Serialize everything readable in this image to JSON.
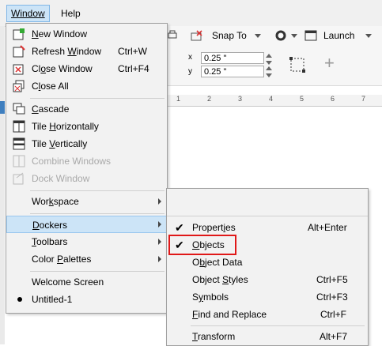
{
  "menubar": {
    "window": "Window",
    "help": "Help"
  },
  "toolbar": {
    "snap_to": "Snap To",
    "launch": "Launch",
    "x_value": "0.25 \"",
    "y_value": "0.25 \"",
    "x_prefix": "x",
    "y_prefix": "y",
    "add": "+"
  },
  "ruler": {
    "ticks": [
      "1",
      "2",
      "3",
      "4",
      "5",
      "6",
      "7"
    ]
  },
  "window_menu": {
    "items": [
      {
        "pre": "",
        "ul": "N",
        "post": "ew Window",
        "shortcut": ""
      },
      {
        "pre": "Refresh ",
        "ul": "W",
        "post": "indow",
        "shortcut": "Ctrl+W"
      },
      {
        "pre": "Cl",
        "ul": "o",
        "post": "se Window",
        "shortcut": "Ctrl+F4"
      },
      {
        "pre": "C",
        "ul": "l",
        "post": "ose All",
        "shortcut": ""
      },
      {
        "pre": "",
        "ul": "C",
        "post": "ascade",
        "shortcut": ""
      },
      {
        "pre": "Tile ",
        "ul": "H",
        "post": "orizontally",
        "shortcut": ""
      },
      {
        "pre": "Tile ",
        "ul": "V",
        "post": "ertically",
        "shortcut": ""
      },
      {
        "pre": "Combine Windows",
        "ul": "",
        "post": "",
        "shortcut": ""
      },
      {
        "pre": "Dock Window",
        "ul": "",
        "post": "",
        "shortcut": ""
      },
      {
        "pre": "Wor",
        "ul": "k",
        "post": "space",
        "shortcut": ""
      },
      {
        "pre": "",
        "ul": "D",
        "post": "ockers",
        "shortcut": ""
      },
      {
        "pre": "",
        "ul": "T",
        "post": "oolbars",
        "shortcut": ""
      },
      {
        "pre": "Color ",
        "ul": "P",
        "post": "alettes",
        "shortcut": ""
      },
      {
        "pre": "Welcome Screen",
        "ul": "",
        "post": "",
        "shortcut": ""
      },
      {
        "pre": "Untitled-1",
        "ul": "",
        "post": "",
        "shortcut": ""
      }
    ]
  },
  "dockers_menu": {
    "items": [
      {
        "pre": "Propert",
        "ul": "i",
        "post": "es",
        "shortcut": "Alt+Enter"
      },
      {
        "pre": "",
        "ul": "O",
        "post": "bjects",
        "shortcut": ""
      },
      {
        "pre": "O",
        "ul": "b",
        "post": "ject Data",
        "shortcut": ""
      },
      {
        "pre": "Object ",
        "ul": "S",
        "post": "tyles",
        "shortcut": "Ctrl+F5"
      },
      {
        "pre": "S",
        "ul": "y",
        "post": "mbols",
        "shortcut": "Ctrl+F3"
      },
      {
        "pre": "",
        "ul": "F",
        "post": "ind and Replace",
        "shortcut": "Ctrl+F"
      },
      {
        "pre": "",
        "ul": "T",
        "post": "ransform",
        "shortcut": "Alt+F7"
      }
    ]
  }
}
